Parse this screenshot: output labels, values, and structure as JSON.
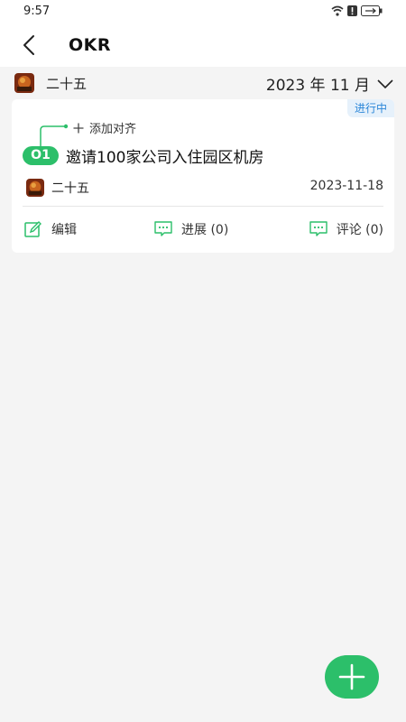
{
  "status_bar": {
    "time": "9:57"
  },
  "header": {
    "title": "OKR"
  },
  "filter": {
    "user": "二十五",
    "year": "2023",
    "year_unit": "年",
    "month": "11",
    "month_unit": "月"
  },
  "okr": {
    "status": "进行中",
    "add_align_label": "添加对齐",
    "badge": "O1",
    "title": "邀请100家公司入住园区机房",
    "owner": "二十五",
    "due_date": "2023-11-18",
    "actions": {
      "edit": "编辑",
      "progress": "进展 (0)",
      "comment": "评论 (0)"
    }
  },
  "colors": {
    "accent": "#2cbf6a",
    "status_badge_text": "#2a86d8",
    "status_badge_bg": "#e6f1fb",
    "background": "#f4f4f4"
  },
  "icons": [
    "wifi-icon",
    "alert-icon",
    "battery-icon",
    "back-arrow-icon",
    "chevron-down-icon",
    "plus-icon",
    "edit-icon",
    "progress-chat-icon",
    "comment-chat-icon",
    "fab-plus-icon"
  ]
}
